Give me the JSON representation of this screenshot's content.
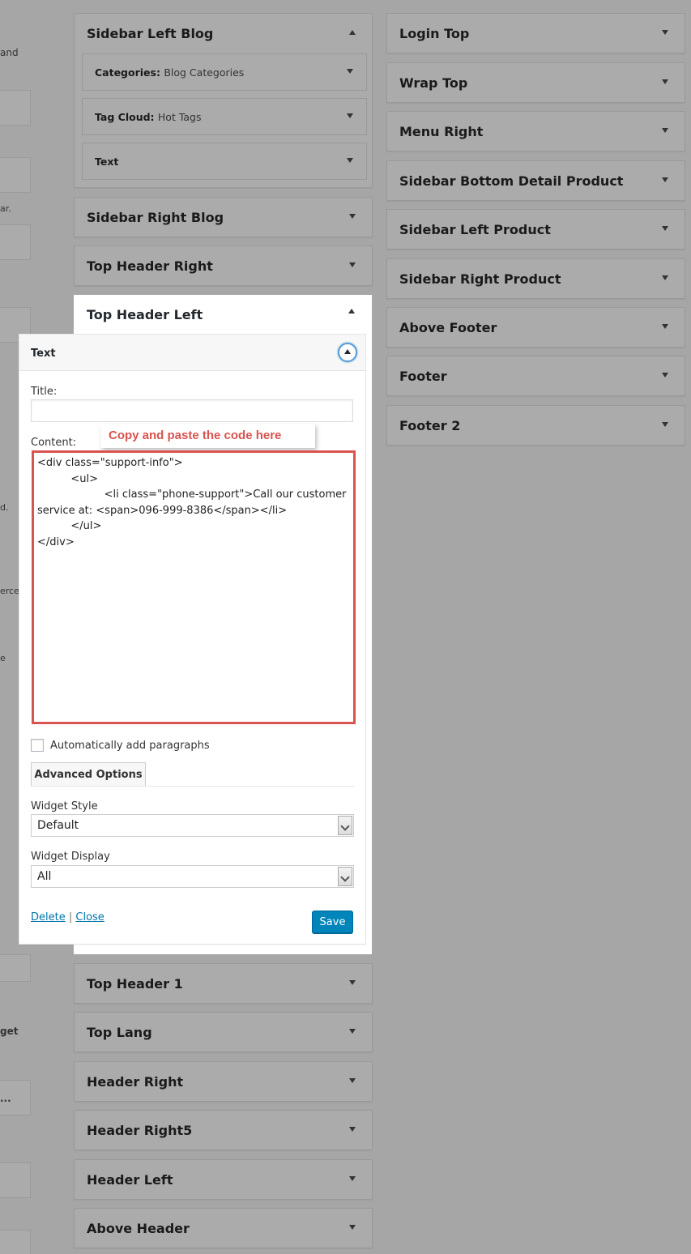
{
  "left_fragments": {
    "t1": "and",
    "t2": "ar.",
    "t3": "d.",
    "t4": "erce",
    "t5": "e",
    "t6": "get",
    "t7": "..."
  },
  "middle_column": {
    "sidebar_left_blog": {
      "title": "Sidebar Left Blog",
      "widgets": [
        {
          "type": "Categories:",
          "instance": "Blog Categories"
        },
        {
          "type": "Tag Cloud:",
          "instance": "Hot Tags"
        },
        {
          "type": "Text",
          "instance": ""
        }
      ]
    },
    "sidebar_right_blog": "Sidebar Right Blog",
    "top_header_right": "Top Header Right",
    "top_header_left": "Top Header Left",
    "below": [
      "Top Header 1",
      "Top Lang",
      "Header Right",
      "Header Right5",
      "Header Left",
      "Above Header"
    ]
  },
  "right_column": [
    "Login Top",
    "Wrap Top",
    "Menu Right",
    "Sidebar Bottom Detail Product",
    "Sidebar Left Product",
    "Sidebar Right Product",
    "Above Footer",
    "Footer",
    "Footer 2"
  ],
  "text_widget": {
    "header": "Text",
    "title_label": "Title:",
    "title_value": "",
    "content_label": "Content:",
    "callout": "Copy and paste the code here",
    "content": "<div class=\"support-info\">\n          <ul>\n                    <li class=\"phone-support\">Call our customer service at: <span>096-999-8386</span></li>\n          </ul>\n</div>",
    "auto_paragraphs_label": "Automatically add paragraphs",
    "auto_paragraphs_checked": false,
    "advanced_options": "Advanced Options",
    "widget_style_label": "Widget Style",
    "widget_style_value": "Default",
    "widget_display_label": "Widget Display",
    "widget_display_value": "All",
    "delete": "Delete",
    "separator": "|",
    "close": "Close",
    "save": "Save"
  },
  "colors": {
    "background": "#a6a6a6",
    "accent": "#0085ba",
    "highlight_red": "#d9534f"
  }
}
